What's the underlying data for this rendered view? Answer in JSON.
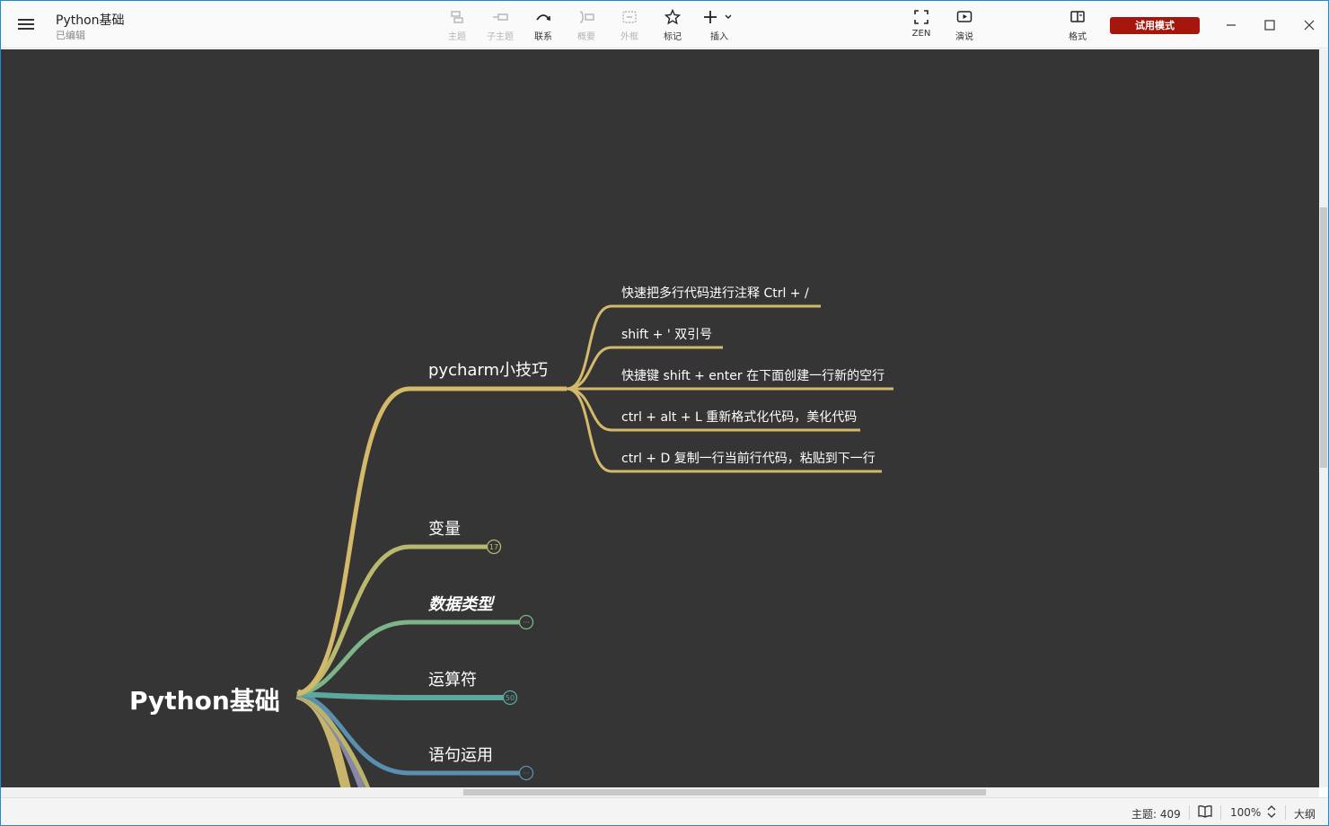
{
  "window": {
    "title": "Python基础",
    "subtitle": "已编辑"
  },
  "toolbar": {
    "items": [
      {
        "label": "主题",
        "icon": "topic-icon",
        "enabled": false
      },
      {
        "label": "子主题",
        "icon": "subtopic-icon",
        "enabled": false
      },
      {
        "label": "联系",
        "icon": "relationship-icon",
        "enabled": true
      },
      {
        "label": "概要",
        "icon": "summary-icon",
        "enabled": false
      },
      {
        "label": "外框",
        "icon": "boundary-icon",
        "enabled": false
      },
      {
        "label": "标记",
        "icon": "star-icon",
        "enabled": true
      },
      {
        "label": "插入",
        "icon": "plus-icon",
        "enabled": true
      },
      {
        "label": "ZEN",
        "icon": "fullscreen-icon",
        "enabled": true
      },
      {
        "label": "演说",
        "icon": "play-icon",
        "enabled": true
      },
      {
        "label": "格式",
        "icon": "panel-icon",
        "enabled": true
      }
    ],
    "trial_label": "试用模式"
  },
  "map": {
    "root": "Python基础",
    "branches": [
      {
        "label": "pycharm小技巧",
        "color": "#d4b96a",
        "italic": false,
        "children": [
          "快速把多行代码进行注释  Ctrl + /",
          "shift + '  双引号",
          "快捷键  shift + enter 在下面创建一行新的空行",
          "ctrl + alt + L 重新格式化代码，美化代码",
          "ctrl + D 复制一行当前行代码，粘贴到下一行"
        ]
      },
      {
        "label": "变量",
        "color": "#b8b96e",
        "italic": false,
        "badge": "17"
      },
      {
        "label": "数据类型",
        "color": "#7db48a",
        "italic": true,
        "badge": "···"
      },
      {
        "label": "运算符",
        "color": "#5aa89e",
        "italic": false,
        "badge": "50"
      },
      {
        "label": "语句运用",
        "color": "#5a8fb0",
        "italic": false,
        "badge": "···"
      }
    ]
  },
  "status": {
    "topics": "主题: 409",
    "zoom": "100%",
    "outline": "大纲"
  },
  "colors": {
    "canvas": "#353535",
    "accent": "#a5170c",
    "branch_gold": "#d4b96a"
  }
}
